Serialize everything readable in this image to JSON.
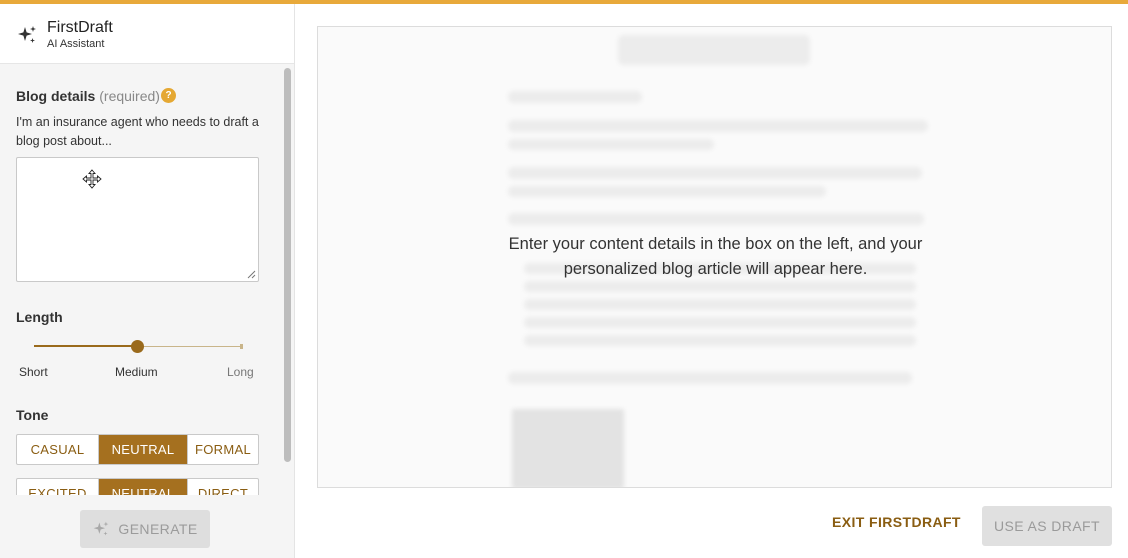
{
  "header": {
    "app_title": "FirstDraft",
    "app_subtitle": "AI Assistant"
  },
  "blog_details": {
    "label": "Blog details",
    "required_hint": "(required)",
    "help_icon": "?",
    "prompt": "I'm an insurance agent who needs to draft a blog post about...",
    "value": ""
  },
  "length": {
    "label": "Length",
    "options": [
      "Short",
      "Medium",
      "Long"
    ],
    "selected": "Medium",
    "slider_fraction": 0.5
  },
  "tone": {
    "label": "Tone",
    "row1": [
      "CASUAL",
      "NEUTRAL",
      "FORMAL"
    ],
    "row1_selected": "NEUTRAL",
    "row2": [
      "EXCITED",
      "NEUTRAL",
      "DIRECT"
    ],
    "row2_selected": "NEUTRAL"
  },
  "footer": {
    "generate_label": "GENERATE"
  },
  "preview": {
    "placeholder_line1": "Enter your content details in the box on the left, and your",
    "placeholder_line2": "personalized blog article will appear here."
  },
  "actions": {
    "exit_label": "EXIT FIRSTDRAFT",
    "use_label": "USE AS DRAFT"
  },
  "colors": {
    "accent_bar": "#e8a93a",
    "brand": "#a5701f",
    "help_badge": "#e5a833"
  },
  "icons": {
    "logo": "sparkle-icon",
    "generate": "sparkle-icon",
    "cursor": "move-cursor-icon"
  }
}
